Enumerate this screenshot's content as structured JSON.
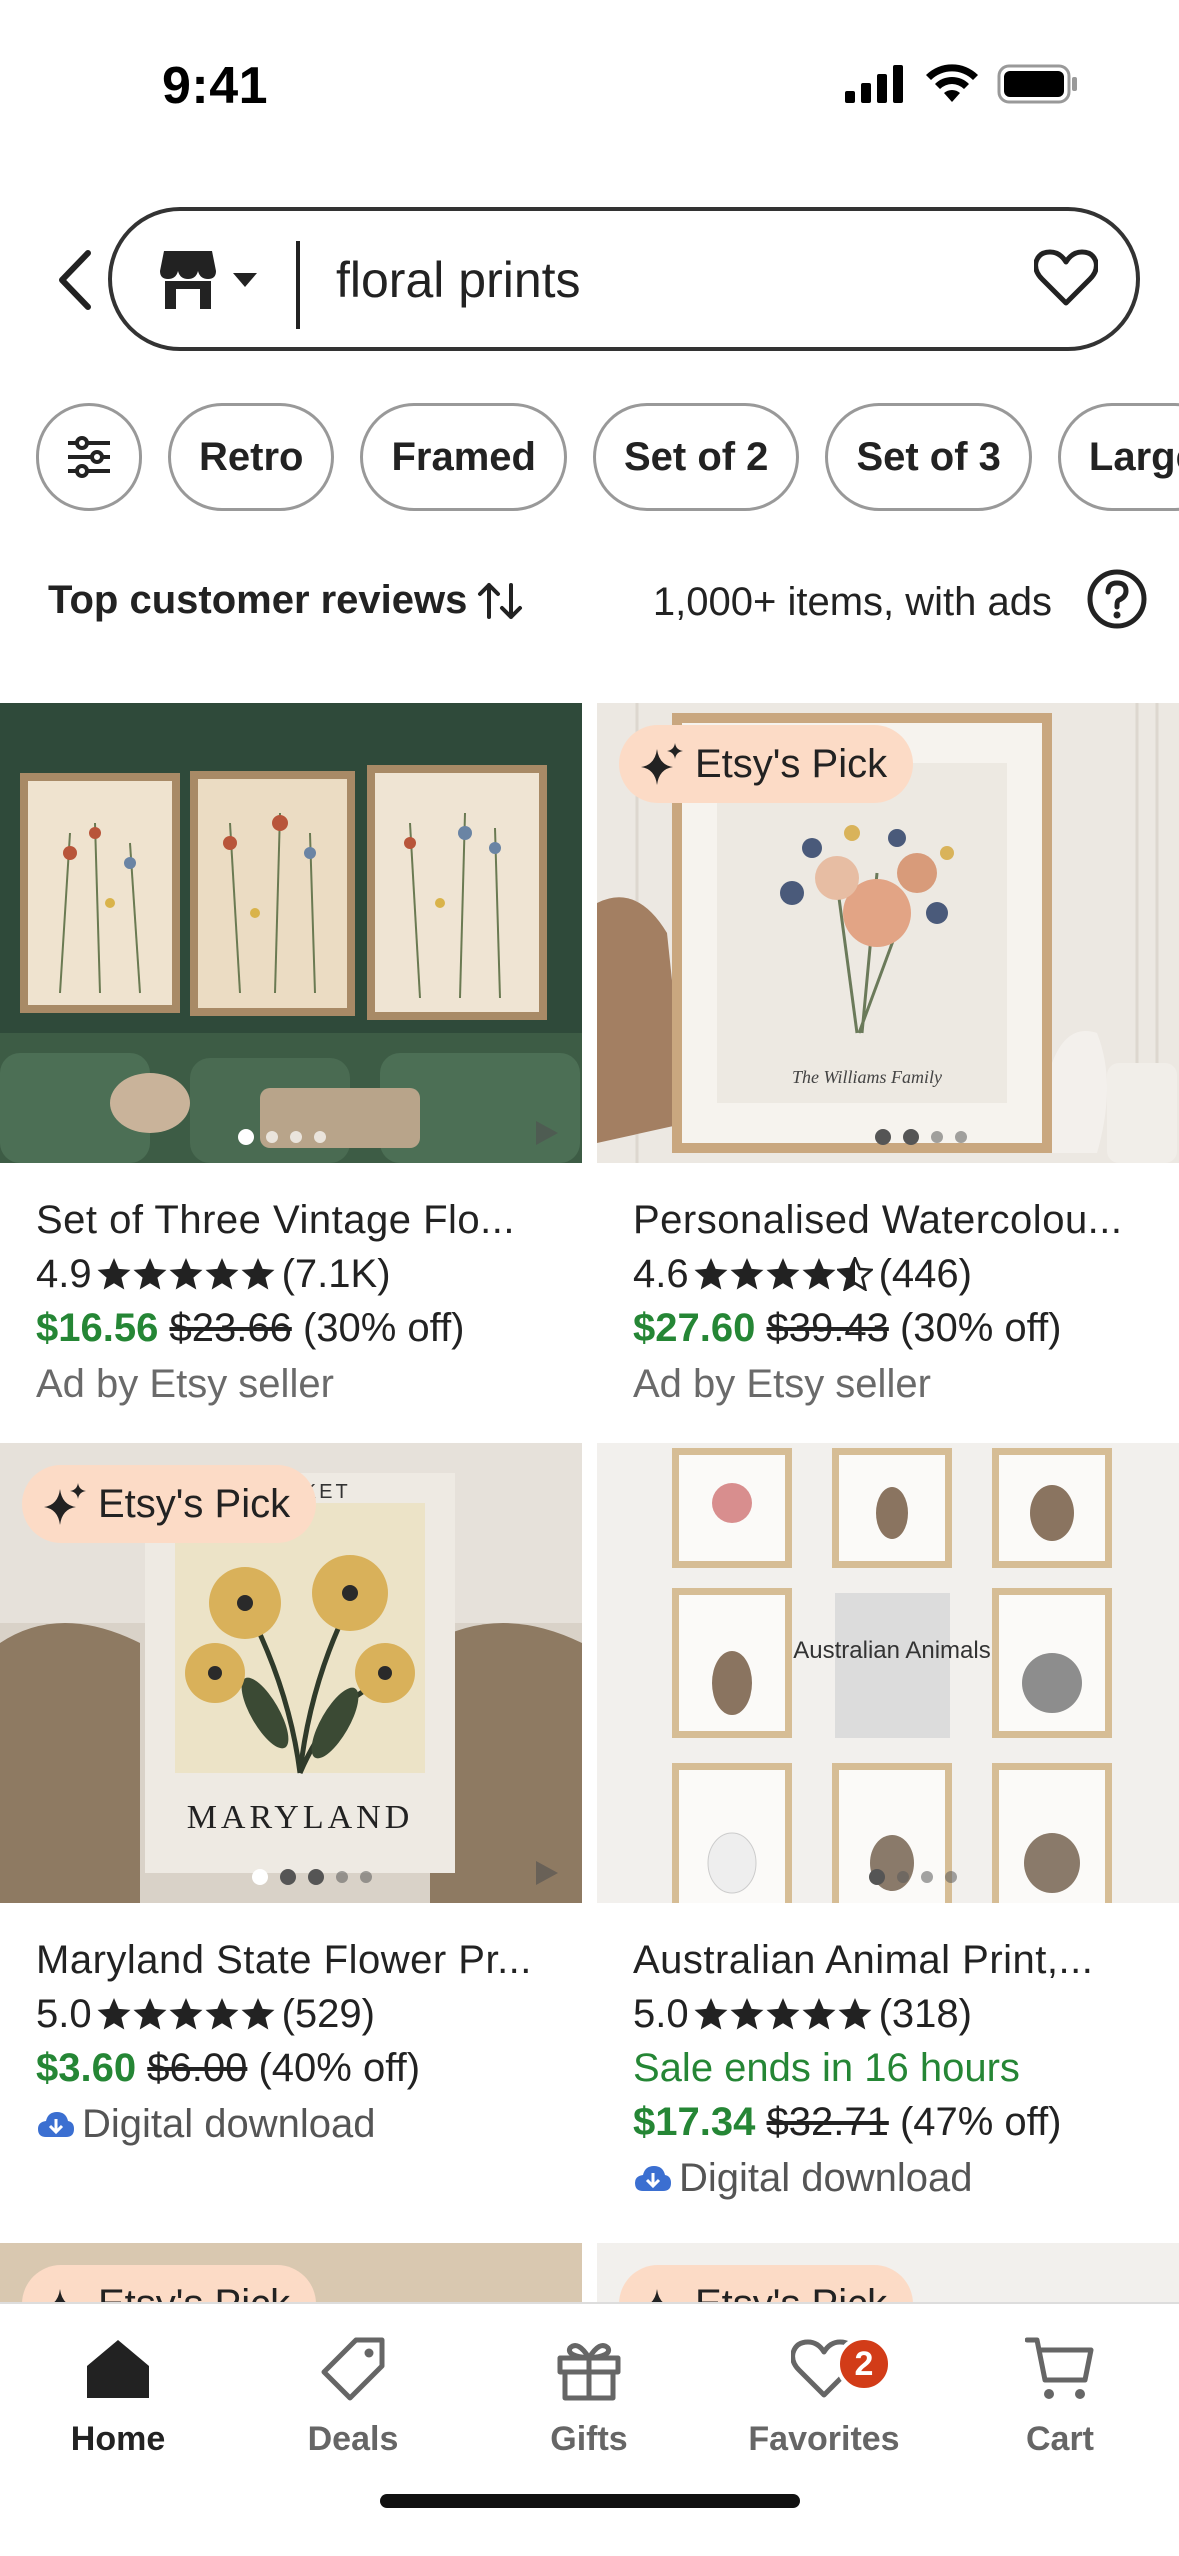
{
  "status": {
    "time": "9:41"
  },
  "search": {
    "query": "floral prints"
  },
  "filters": [
    "Retro",
    "Framed",
    "Set of 2",
    "Set of 3",
    "Large"
  ],
  "sort": {
    "label": "Top customer reviews",
    "results": "1,000+ items, with ads"
  },
  "listings": [
    {
      "title": "Set of Three Vintage Flo...",
      "rating": "4.9",
      "stars": 5,
      "reviews": "(7.1K)",
      "price": "$16.56",
      "old_price": "$23.66",
      "discount": "(30% off)",
      "meta": "Ad by Etsy seller",
      "badge": ""
    },
    {
      "title": "Personalised Watercolou...",
      "rating": "4.6",
      "stars": 4.5,
      "reviews": "(446)",
      "price": "$27.60",
      "old_price": "$39.43",
      "discount": "(30% off)",
      "meta": "Ad by Etsy seller",
      "badge": "Etsy's Pick",
      "art_text": "The Williams Family"
    },
    {
      "title": "Maryland State Flower Pr...",
      "rating": "5.0",
      "stars": 5,
      "reviews": "(529)",
      "price": "$3.60",
      "old_price": "$6.00",
      "discount": "(40% off)",
      "meta": "Digital download",
      "badge": "Etsy's Pick",
      "art_text": "MARYLAND",
      "art_top": "MARKET"
    },
    {
      "title": "Australian Animal Print,...",
      "rating": "5.0",
      "stars": 5,
      "reviews": "(318)",
      "sale": "Sale ends in 16 hours",
      "price": "$17.34",
      "old_price": "$32.71",
      "discount": "(47% off)",
      "meta": "Digital download",
      "badge": "",
      "art_text": "Australian Animals"
    }
  ],
  "peek_badge": "Etsy's Pick",
  "tabs": [
    {
      "label": "Home",
      "icon": "home-icon"
    },
    {
      "label": "Deals",
      "icon": "tag-icon"
    },
    {
      "label": "Gifts",
      "icon": "gift-icon"
    },
    {
      "label": "Favorites",
      "icon": "heart-icon",
      "badge": "2"
    },
    {
      "label": "Cart",
      "icon": "cart-icon"
    }
  ],
  "colors": {
    "price_green": "#258635",
    "badge_peach": "#fcdbc6",
    "notif_red": "#d23c18"
  }
}
